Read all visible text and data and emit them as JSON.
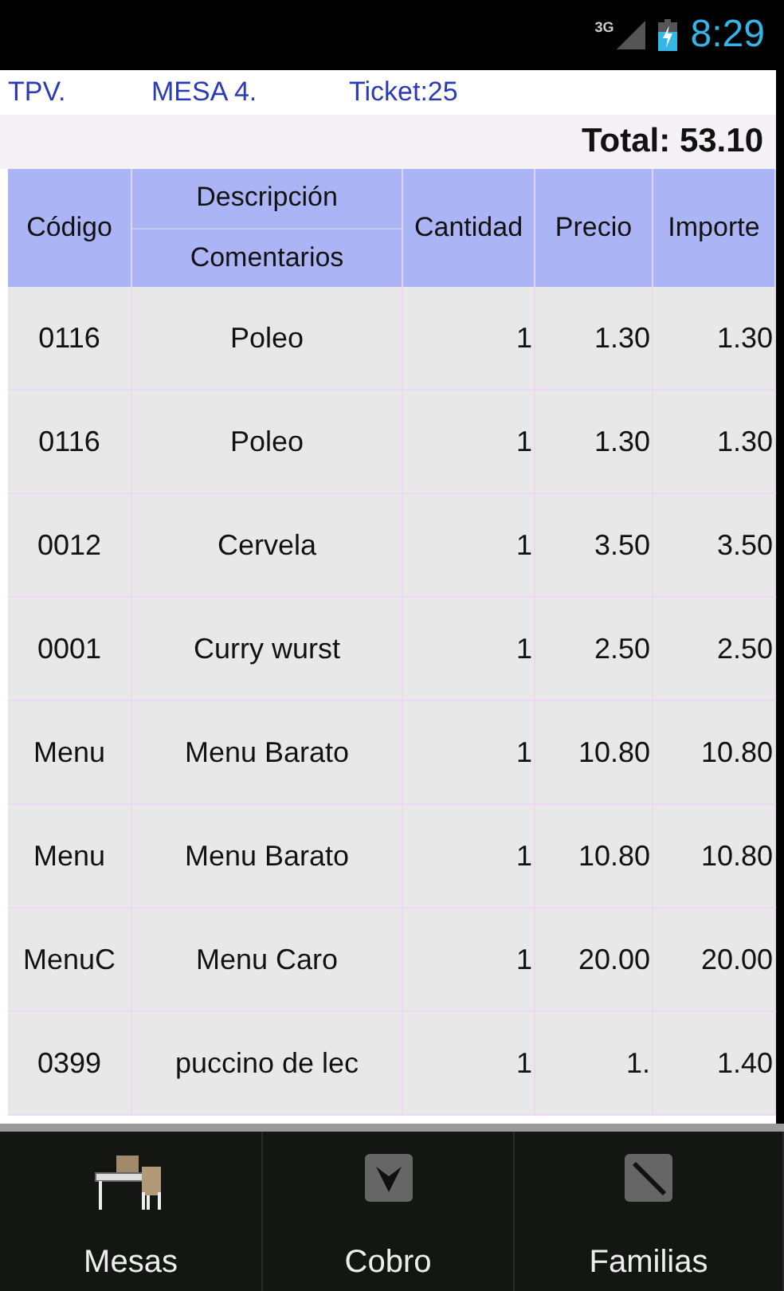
{
  "status_bar": {
    "network": "3G",
    "time": "8:29"
  },
  "header": {
    "app": "TPV.",
    "table": "MESA 4.",
    "ticket": "Ticket:25"
  },
  "total": "Total: 53.10",
  "table": {
    "columns": [
      {
        "label": "Código"
      },
      {
        "label": "Descripción",
        "sublabel": "Comentarios"
      },
      {
        "label": "Cantidad"
      },
      {
        "label": "Precio"
      },
      {
        "label": "Importe"
      }
    ],
    "rows": [
      [
        "0116",
        "Poleo",
        "1",
        "1.30",
        "1.30"
      ],
      [
        "0116",
        "Poleo",
        "1",
        "1.30",
        "1.30"
      ],
      [
        "0012",
        "Cervela",
        "1",
        "3.50",
        "3.50"
      ],
      [
        "0001",
        "Curry wurst",
        "1",
        "2.50",
        "2.50"
      ],
      [
        "Menu",
        "Menu Barato",
        "1",
        "10.80",
        "10.80"
      ],
      [
        "Menu",
        "Menu Barato",
        "1",
        "10.80",
        "10.80"
      ],
      [
        "MenuC",
        "Menu Caro",
        "1",
        "20.00",
        "20.00"
      ],
      [
        "0399",
        "puccino de lec",
        "1",
        "1.",
        "1.40"
      ]
    ]
  },
  "bottom_bar": [
    {
      "label": "Mesas",
      "kind": "table"
    },
    {
      "label": "Cobro",
      "kind": "checkout"
    },
    {
      "label": "Familias",
      "kind": "families"
    }
  ]
}
